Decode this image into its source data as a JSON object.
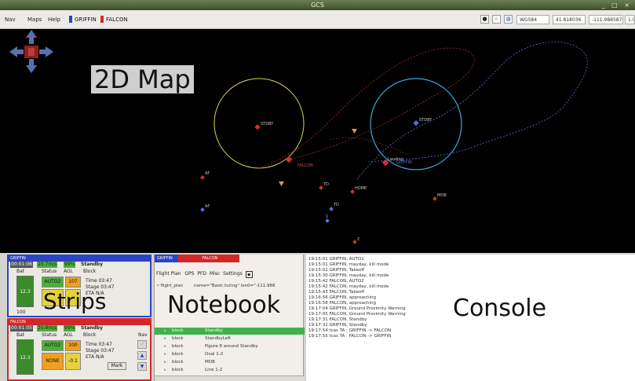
{
  "window": {
    "title": "GCS",
    "controls": "_ □ ×"
  },
  "menubar": {
    "menus": [
      "Nav",
      "Maps",
      "Help"
    ],
    "aircraft": [
      {
        "name": "GRIFFIN",
        "color": "#2a44c8"
      },
      {
        "name": "FALCON",
        "color": "#d2282a"
      }
    ],
    "waypoint_field": "WGS84",
    "lat_field": "41.818036",
    "lon_field": "-111.988587",
    "zoom_field": "1.0"
  },
  "map": {
    "label": "2D Map",
    "waypoints": [
      {
        "name": "STDBY"
      },
      {
        "name": "FALCON"
      },
      {
        "name": "GRIFFIN"
      },
      {
        "name": "STDBY"
      },
      {
        "name": "AF"
      },
      {
        "name": "TD"
      },
      {
        "name": "HOME"
      },
      {
        "name": "MOB"
      },
      {
        "name": "AF"
      },
      {
        "name": "TD"
      },
      {
        "name": "1"
      },
      {
        "name": "2"
      },
      {
        "name": "Landing"
      }
    ]
  },
  "strips": {
    "label": "Strips",
    "griffin": {
      "header": "GRIFFIN",
      "row": [
        "00:01:06",
        "20.7m/s",
        "99%",
        "Standby"
      ],
      "cols": [
        "Bat",
        "Status",
        "AGL",
        "Block"
      ],
      "status": "AUTO2",
      "agl": "107",
      "bat": "12.3",
      "time": "Time  03:47",
      "stage": "Stage 03:47",
      "eta": "ETA  N/A",
      "bottom_bat": "100"
    },
    "falcon": {
      "header": "FALCON",
      "row": [
        "00:01:05",
        "20.8m/s",
        "99%",
        "Standby"
      ],
      "cols": [
        "Bat",
        "Status",
        "AGL",
        "Block"
      ],
      "extra_col": "Nav",
      "status": "AUTO2",
      "agl": "100",
      "bat": "12.3",
      "mode2": "NONE",
      "gps": "-0.1",
      "time": "Time  03:47",
      "stage": "Stage 03:47",
      "eta": "ETA  N/A",
      "mark": "Mark"
    }
  },
  "notebook": {
    "label": "Notebook",
    "tabs": [
      "GRIFFIN",
      "FALCON"
    ],
    "subtabs": [
      "Flight Plan",
      "GPS",
      "PFD",
      "Misc",
      "Settings"
    ],
    "flight_plan_header": "flight_plan",
    "flight_plan_attr": "name=\"Basic.turing\" lon0=\"-111.988",
    "blocks": [
      {
        "name": "block",
        "value": "Standby"
      },
      {
        "name": "block",
        "value": "StandbyLeft"
      },
      {
        "name": "block",
        "value": "Figure 8 around Standby"
      },
      {
        "name": "block",
        "value": "Oval 1-2"
      },
      {
        "name": "block",
        "value": "MOB"
      },
      {
        "name": "block",
        "value": "Line 1-2"
      }
    ]
  },
  "console": {
    "label": "Console",
    "lines": [
      "19:15:01 GRIFFIN, AUTO2",
      "19:15:01 GRIFFIN, mayday, kill mode",
      "19:15:02 GRIFFIN, Takeoff",
      "19:15:30 GRIFFIN, mayday, kill mode",
      "19:15:42 FALCON, AUTO2",
      "19:15:42 FALCON, mayday, kill mode",
      "19:15:43 FALCON, Takeoff",
      "19:16:56 GRIFFIN, approaching",
      "19:16:58 FALCON, approaching",
      "19:17:04 GRIFFIN, Ground Proximity Warning",
      "19:17:05 FALCON, Ground Proximity Warning",
      "19:17:31 FALCON, Standby",
      "19:17:32 GRIFFIN, Standby",
      "19:17:54 tcas TA : GRIFFIN -> FALCON",
      "19:17:55 tcas TA : FALCON -> GRIFFIN"
    ]
  },
  "colors": {
    "griffin": "#2a44c8",
    "falcon": "#d2282a",
    "green": "#4caf3a",
    "yellow": "#e6d23c",
    "orange": "#f0a020"
  },
  "icons": [
    "pan-arrows-icon",
    "center-icon",
    "zoom-icon",
    "save-icon",
    "up-arrow-icon",
    "down-arrow-icon"
  ]
}
